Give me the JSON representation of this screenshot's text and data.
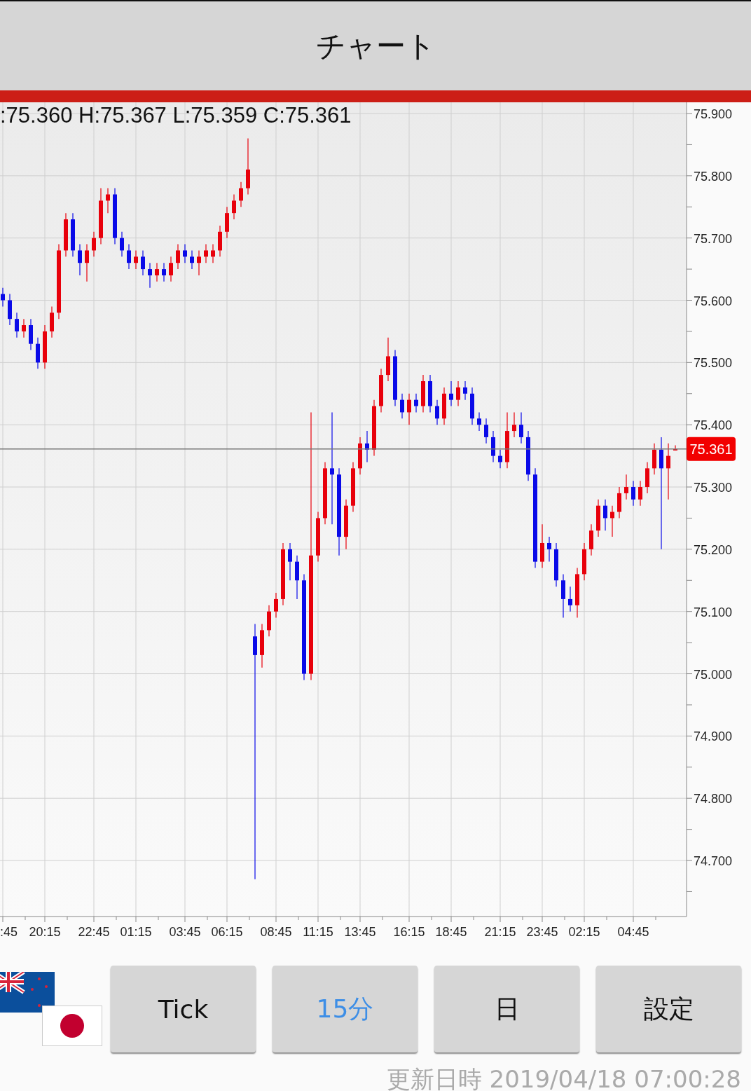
{
  "header": {
    "title": "チャート"
  },
  "chart": {
    "ohlc": ":75.360 H:75.367 L:75.359 C:75.361",
    "chart_data": {
      "type": "candlestick",
      "ylim": [
        74.61,
        75.918
      ],
      "grid": true,
      "yticks": [
        {
          "value": 75.9,
          "label": "75.900"
        },
        {
          "value": 75.8,
          "label": "75.800"
        },
        {
          "value": 75.7,
          "label": "75.700"
        },
        {
          "value": 75.6,
          "label": "75.600"
        },
        {
          "value": 75.5,
          "label": "75.500"
        },
        {
          "value": 75.4,
          "label": "75.400"
        },
        {
          "value": 75.3,
          "label": "75.300"
        },
        {
          "value": 75.2,
          "label": "75.200"
        },
        {
          "value": 75.1,
          "label": "75.100"
        },
        {
          "value": 75.0,
          "label": "75.000"
        },
        {
          "value": 74.9,
          "label": "74.900"
        },
        {
          "value": 74.8,
          "label": "74.800"
        },
        {
          "value": 74.7,
          "label": "74.700"
        }
      ],
      "ref_lines": [
        {
          "axis": "y",
          "value": 75.361,
          "label": "75.361"
        }
      ],
      "categories": [
        ":45",
        null,
        null,
        null,
        null,
        null,
        "20:15",
        null,
        null,
        null,
        null,
        null,
        null,
        "22:45",
        null,
        null,
        null,
        null,
        null,
        "01:15",
        null,
        null,
        null,
        null,
        null,
        null,
        "03:45",
        null,
        null,
        null,
        null,
        null,
        "06:15",
        null,
        null,
        null,
        null,
        null,
        null,
        "08:45",
        null,
        null,
        null,
        null,
        null,
        "11:15",
        null,
        null,
        null,
        null,
        null,
        "13:45",
        null,
        null,
        null,
        null,
        null,
        null,
        "16:15",
        null,
        null,
        null,
        null,
        null,
        "18:45",
        null,
        null,
        null,
        null,
        null,
        null,
        "21:15",
        null,
        null,
        null,
        null,
        null,
        "23:45",
        null,
        null,
        null,
        null,
        null,
        "02:15",
        null,
        null,
        null,
        null,
        null,
        null,
        "04:45",
        null,
        null,
        null,
        null,
        null,
        null
      ],
      "ohlc": [
        [
          75.61,
          75.62,
          75.59,
          75.6
        ],
        [
          75.6,
          75.61,
          75.56,
          75.57
        ],
        [
          75.57,
          75.58,
          75.54,
          75.55
        ],
        [
          75.55,
          75.57,
          75.54,
          75.56
        ],
        [
          75.56,
          75.57,
          75.52,
          75.53
        ],
        [
          75.53,
          75.54,
          75.49,
          75.5
        ],
        [
          75.5,
          75.56,
          75.49,
          75.55
        ],
        [
          75.55,
          75.59,
          75.54,
          75.58
        ],
        [
          75.58,
          75.69,
          75.57,
          75.68
        ],
        [
          75.68,
          75.74,
          75.67,
          75.73
        ],
        [
          75.73,
          75.74,
          75.67,
          75.68
        ],
        [
          75.68,
          75.69,
          75.64,
          75.66
        ],
        [
          75.66,
          75.69,
          75.63,
          75.68
        ],
        [
          75.68,
          75.71,
          75.67,
          75.7
        ],
        [
          75.7,
          75.78,
          75.69,
          75.76
        ],
        [
          75.76,
          75.78,
          75.74,
          75.77
        ],
        [
          75.77,
          75.78,
          75.69,
          75.7
        ],
        [
          75.7,
          75.71,
          75.67,
          75.68
        ],
        [
          75.68,
          75.69,
          75.65,
          75.66
        ],
        [
          75.66,
          75.68,
          75.65,
          75.67
        ],
        [
          75.67,
          75.68,
          75.64,
          75.65
        ],
        [
          75.65,
          75.66,
          75.62,
          75.64
        ],
        [
          75.64,
          75.66,
          75.63,
          75.65
        ],
        [
          75.65,
          75.66,
          75.63,
          75.64
        ],
        [
          75.64,
          75.67,
          75.63,
          75.66
        ],
        [
          75.66,
          75.69,
          75.65,
          75.68
        ],
        [
          75.68,
          75.69,
          75.66,
          75.67
        ],
        [
          75.67,
          75.68,
          75.65,
          75.66
        ],
        [
          75.66,
          75.68,
          75.64,
          75.67
        ],
        [
          75.67,
          75.69,
          75.66,
          75.68
        ],
        [
          75.67,
          75.69,
          75.66,
          75.68
        ],
        [
          75.68,
          75.72,
          75.67,
          75.71
        ],
        [
          75.71,
          75.75,
          75.7,
          75.74
        ],
        [
          75.74,
          75.77,
          75.73,
          75.76
        ],
        [
          75.76,
          75.79,
          75.75,
          75.78
        ],
        [
          75.78,
          75.86,
          75.77,
          75.81
        ],
        [
          75.06,
          75.08,
          74.67,
          75.03
        ],
        [
          75.03,
          75.08,
          75.01,
          75.07
        ],
        [
          75.07,
          75.11,
          75.06,
          75.1
        ],
        [
          75.1,
          75.13,
          75.09,
          75.12
        ],
        [
          75.12,
          75.21,
          75.11,
          75.2
        ],
        [
          75.2,
          75.21,
          75.15,
          75.18
        ],
        [
          75.18,
          75.19,
          75.12,
          75.15
        ],
        [
          75.15,
          75.16,
          74.99,
          75.0
        ],
        [
          75.0,
          75.42,
          74.99,
          75.19
        ],
        [
          75.19,
          75.26,
          75.18,
          75.25
        ],
        [
          75.25,
          75.34,
          75.24,
          75.33
        ],
        [
          75.33,
          75.42,
          75.24,
          75.32
        ],
        [
          75.32,
          75.33,
          75.19,
          75.22
        ],
        [
          75.22,
          75.28,
          75.2,
          75.27
        ],
        [
          75.27,
          75.34,
          75.26,
          75.33
        ],
        [
          75.33,
          75.38,
          75.32,
          75.37
        ],
        [
          75.37,
          75.39,
          75.34,
          75.36
        ],
        [
          75.36,
          75.44,
          75.35,
          75.43
        ],
        [
          75.43,
          75.49,
          75.42,
          75.48
        ],
        [
          75.48,
          75.54,
          75.47,
          75.51
        ],
        [
          75.51,
          75.52,
          75.43,
          75.44
        ],
        [
          75.44,
          75.45,
          75.41,
          75.42
        ],
        [
          75.42,
          75.45,
          75.4,
          75.44
        ],
        [
          75.44,
          75.45,
          75.42,
          75.43
        ],
        [
          75.43,
          75.48,
          75.42,
          75.47
        ],
        [
          75.47,
          75.48,
          75.42,
          75.43
        ],
        [
          75.43,
          75.44,
          75.4,
          75.41
        ],
        [
          75.41,
          75.46,
          75.4,
          75.45
        ],
        [
          75.45,
          75.47,
          75.43,
          75.44
        ],
        [
          75.44,
          75.47,
          75.43,
          75.46
        ],
        [
          75.46,
          75.47,
          75.44,
          75.45
        ],
        [
          75.45,
          75.46,
          75.4,
          75.41
        ],
        [
          75.41,
          75.42,
          75.39,
          75.4
        ],
        [
          75.4,
          75.41,
          75.37,
          75.38
        ],
        [
          75.38,
          75.39,
          75.34,
          75.35
        ],
        [
          75.35,
          75.36,
          75.33,
          75.34
        ],
        [
          75.34,
          75.42,
          75.33,
          75.39
        ],
        [
          75.39,
          75.42,
          75.38,
          75.4
        ],
        [
          75.4,
          75.42,
          75.37,
          75.38
        ],
        [
          75.38,
          75.39,
          75.31,
          75.32
        ],
        [
          75.32,
          75.33,
          75.17,
          75.18
        ],
        [
          75.18,
          75.24,
          75.17,
          75.21
        ],
        [
          75.21,
          75.22,
          75.18,
          75.2
        ],
        [
          75.2,
          75.21,
          75.14,
          75.15
        ],
        [
          75.15,
          75.16,
          75.09,
          75.12
        ],
        [
          75.12,
          75.14,
          75.1,
          75.11
        ],
        [
          75.11,
          75.17,
          75.09,
          75.16
        ],
        [
          75.16,
          75.21,
          75.15,
          75.2
        ],
        [
          75.2,
          75.24,
          75.19,
          75.23
        ],
        [
          75.23,
          75.28,
          75.22,
          75.27
        ],
        [
          75.27,
          75.28,
          75.23,
          75.25
        ],
        [
          75.25,
          75.27,
          75.22,
          75.26
        ],
        [
          75.26,
          75.3,
          75.25,
          75.29
        ],
        [
          75.29,
          75.32,
          75.28,
          75.3
        ],
        [
          75.3,
          75.31,
          75.27,
          75.28
        ],
        [
          75.28,
          75.31,
          75.27,
          75.3
        ],
        [
          75.3,
          75.34,
          75.29,
          75.33
        ],
        [
          75.33,
          75.37,
          75.32,
          75.36
        ],
        [
          75.36,
          75.38,
          75.2,
          75.33
        ],
        [
          75.33,
          75.37,
          75.28,
          75.35
        ],
        [
          75.36,
          75.367,
          75.359,
          75.361
        ]
      ]
    }
  },
  "buttons": [
    {
      "label": "Tick",
      "selected": false
    },
    {
      "label": "15分",
      "selected": true
    },
    {
      "label": "日",
      "selected": false
    },
    {
      "label": "設定",
      "selected": false
    }
  ],
  "footer": {
    "updated": "更新日時 2019/04/18 07:00:28"
  }
}
